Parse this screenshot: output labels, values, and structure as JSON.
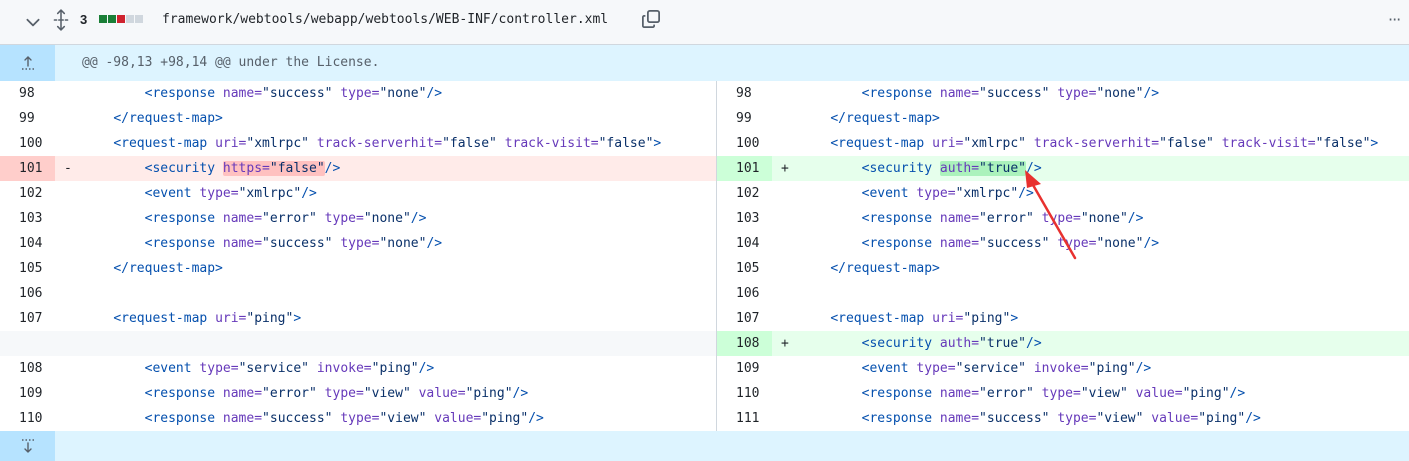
{
  "file": {
    "changes_count": "3",
    "path": "framework/webtools/webapp/webtools/WEB-INF/controller.xml",
    "diffstat": [
      "#1a7f37",
      "#1a7f37",
      "#cf222e",
      "#d0d7de",
      "#d0d7de"
    ],
    "icons": [
      "chevron-down-icon",
      "unfold-icon",
      "copy-icon",
      "kebab-horizontal-icon",
      "fold-up-icon",
      "fold-down-icon"
    ]
  },
  "hunk": {
    "header": "@@ -98,13 +98,14 @@ under the License."
  },
  "left": {
    "rows": [
      {
        "num": "98",
        "type": "ctx",
        "marker": "",
        "indent": "        ",
        "parts": [
          [
            "tag",
            "<response "
          ],
          [
            "attr",
            "name="
          ],
          [
            "str",
            "\"success\""
          ],
          [
            "plain",
            " "
          ],
          [
            "attr",
            "type="
          ],
          [
            "str",
            "\"none\""
          ],
          [
            "tag",
            "/>"
          ]
        ]
      },
      {
        "num": "99",
        "type": "ctx",
        "marker": "",
        "indent": "    ",
        "parts": [
          [
            "tag",
            "</request-map>"
          ]
        ]
      },
      {
        "num": "100",
        "type": "ctx",
        "marker": "",
        "indent": "    ",
        "parts": [
          [
            "tag",
            "<request-map "
          ],
          [
            "attr",
            "uri="
          ],
          [
            "str",
            "\"xmlrpc\""
          ],
          [
            "plain",
            " "
          ],
          [
            "attr",
            "track-serverhit="
          ],
          [
            "str",
            "\"false\""
          ],
          [
            "plain",
            " "
          ],
          [
            "attr",
            "track-visit="
          ],
          [
            "str",
            "\"false\""
          ],
          [
            "tag",
            ">"
          ]
        ]
      },
      {
        "num": "101",
        "type": "del",
        "marker": "-",
        "indent": "        ",
        "parts": [
          [
            "tag",
            "<security "
          ],
          [
            "hl-attr",
            "https="
          ],
          [
            "hl-str",
            "\"false\""
          ],
          [
            "tag",
            "/>"
          ]
        ]
      },
      {
        "num": "102",
        "type": "ctx",
        "marker": "",
        "indent": "        ",
        "parts": [
          [
            "tag",
            "<event "
          ],
          [
            "attr",
            "type="
          ],
          [
            "str",
            "\"xmlrpc\""
          ],
          [
            "tag",
            "/>"
          ]
        ]
      },
      {
        "num": "103",
        "type": "ctx",
        "marker": "",
        "indent": "        ",
        "parts": [
          [
            "tag",
            "<response "
          ],
          [
            "attr",
            "name="
          ],
          [
            "str",
            "\"error\""
          ],
          [
            "plain",
            " "
          ],
          [
            "attr",
            "type="
          ],
          [
            "str",
            "\"none\""
          ],
          [
            "tag",
            "/>"
          ]
        ]
      },
      {
        "num": "104",
        "type": "ctx",
        "marker": "",
        "indent": "        ",
        "parts": [
          [
            "tag",
            "<response "
          ],
          [
            "attr",
            "name="
          ],
          [
            "str",
            "\"success\""
          ],
          [
            "plain",
            " "
          ],
          [
            "attr",
            "type="
          ],
          [
            "str",
            "\"none\""
          ],
          [
            "tag",
            "/>"
          ]
        ]
      },
      {
        "num": "105",
        "type": "ctx",
        "marker": "",
        "indent": "    ",
        "parts": [
          [
            "tag",
            "</request-map>"
          ]
        ]
      },
      {
        "num": "106",
        "type": "ctx",
        "marker": "",
        "indent": "",
        "parts": []
      },
      {
        "num": "107",
        "type": "ctx",
        "marker": "",
        "indent": "    ",
        "parts": [
          [
            "tag",
            "<request-map "
          ],
          [
            "attr",
            "uri="
          ],
          [
            "str",
            "\"ping\""
          ],
          [
            "tag",
            ">"
          ]
        ]
      },
      {
        "num": "",
        "type": "empty",
        "marker": "",
        "indent": "",
        "parts": []
      },
      {
        "num": "108",
        "type": "ctx",
        "marker": "",
        "indent": "        ",
        "parts": [
          [
            "tag",
            "<event "
          ],
          [
            "attr",
            "type="
          ],
          [
            "str",
            "\"service\""
          ],
          [
            "plain",
            " "
          ],
          [
            "attr",
            "invoke="
          ],
          [
            "str",
            "\"ping\""
          ],
          [
            "tag",
            "/>"
          ]
        ]
      },
      {
        "num": "109",
        "type": "ctx",
        "marker": "",
        "indent": "        ",
        "parts": [
          [
            "tag",
            "<response "
          ],
          [
            "attr",
            "name="
          ],
          [
            "str",
            "\"error\""
          ],
          [
            "plain",
            " "
          ],
          [
            "attr",
            "type="
          ],
          [
            "str",
            "\"view\""
          ],
          [
            "plain",
            " "
          ],
          [
            "attr",
            "value="
          ],
          [
            "str",
            "\"ping\""
          ],
          [
            "tag",
            "/>"
          ]
        ]
      },
      {
        "num": "110",
        "type": "ctx",
        "marker": "",
        "indent": "        ",
        "parts": [
          [
            "tag",
            "<response "
          ],
          [
            "attr",
            "name="
          ],
          [
            "str",
            "\"success\""
          ],
          [
            "plain",
            " "
          ],
          [
            "attr",
            "type="
          ],
          [
            "str",
            "\"view\""
          ],
          [
            "plain",
            " "
          ],
          [
            "attr",
            "value="
          ],
          [
            "str",
            "\"ping\""
          ],
          [
            "tag",
            "/>"
          ]
        ]
      }
    ]
  },
  "right": {
    "rows": [
      {
        "num": "98",
        "type": "ctx",
        "marker": "",
        "indent": "        ",
        "parts": [
          [
            "tag",
            "<response "
          ],
          [
            "attr",
            "name="
          ],
          [
            "str",
            "\"success\""
          ],
          [
            "plain",
            " "
          ],
          [
            "attr",
            "type="
          ],
          [
            "str",
            "\"none\""
          ],
          [
            "tag",
            "/>"
          ]
        ]
      },
      {
        "num": "99",
        "type": "ctx",
        "marker": "",
        "indent": "    ",
        "parts": [
          [
            "tag",
            "</request-map>"
          ]
        ]
      },
      {
        "num": "100",
        "type": "ctx",
        "marker": "",
        "indent": "    ",
        "parts": [
          [
            "tag",
            "<request-map "
          ],
          [
            "attr",
            "uri="
          ],
          [
            "str",
            "\"xmlrpc\""
          ],
          [
            "plain",
            " "
          ],
          [
            "attr",
            "track-serverhit="
          ],
          [
            "str",
            "\"false\""
          ],
          [
            "plain",
            " "
          ],
          [
            "attr",
            "track-visit="
          ],
          [
            "str",
            "\"false\""
          ],
          [
            "tag",
            ">"
          ]
        ]
      },
      {
        "num": "101",
        "type": "add",
        "marker": "+",
        "indent": "        ",
        "parts": [
          [
            "tag",
            "<security "
          ],
          [
            "hl-attr",
            "auth="
          ],
          [
            "hl-str",
            "\"true\""
          ],
          [
            "tag",
            "/>"
          ]
        ]
      },
      {
        "num": "102",
        "type": "ctx",
        "marker": "",
        "indent": "        ",
        "parts": [
          [
            "tag",
            "<event "
          ],
          [
            "attr",
            "type="
          ],
          [
            "str",
            "\"xmlrpc\""
          ],
          [
            "tag",
            "/>"
          ]
        ]
      },
      {
        "num": "103",
        "type": "ctx",
        "marker": "",
        "indent": "        ",
        "parts": [
          [
            "tag",
            "<response "
          ],
          [
            "attr",
            "name="
          ],
          [
            "str",
            "\"error\""
          ],
          [
            "plain",
            " "
          ],
          [
            "attr",
            "type="
          ],
          [
            "str",
            "\"none\""
          ],
          [
            "tag",
            "/>"
          ]
        ]
      },
      {
        "num": "104",
        "type": "ctx",
        "marker": "",
        "indent": "        ",
        "parts": [
          [
            "tag",
            "<response "
          ],
          [
            "attr",
            "name="
          ],
          [
            "str",
            "\"success\""
          ],
          [
            "plain",
            " "
          ],
          [
            "attr",
            "type="
          ],
          [
            "str",
            "\"none\""
          ],
          [
            "tag",
            "/>"
          ]
        ]
      },
      {
        "num": "105",
        "type": "ctx",
        "marker": "",
        "indent": "    ",
        "parts": [
          [
            "tag",
            "</request-map>"
          ]
        ]
      },
      {
        "num": "106",
        "type": "ctx",
        "marker": "",
        "indent": "",
        "parts": []
      },
      {
        "num": "107",
        "type": "ctx",
        "marker": "",
        "indent": "    ",
        "parts": [
          [
            "tag",
            "<request-map "
          ],
          [
            "attr",
            "uri="
          ],
          [
            "str",
            "\"ping\""
          ],
          [
            "tag",
            ">"
          ]
        ]
      },
      {
        "num": "108",
        "type": "add",
        "marker": "+",
        "indent": "        ",
        "parts": [
          [
            "tag",
            "<security "
          ],
          [
            "attr",
            "auth="
          ],
          [
            "str",
            "\"true\""
          ],
          [
            "tag",
            "/>"
          ]
        ]
      },
      {
        "num": "109",
        "type": "ctx",
        "marker": "",
        "indent": "        ",
        "parts": [
          [
            "tag",
            "<event "
          ],
          [
            "attr",
            "type="
          ],
          [
            "str",
            "\"service\""
          ],
          [
            "plain",
            " "
          ],
          [
            "attr",
            "invoke="
          ],
          [
            "str",
            "\"ping\""
          ],
          [
            "tag",
            "/>"
          ]
        ]
      },
      {
        "num": "110",
        "type": "ctx",
        "marker": "",
        "indent": "        ",
        "parts": [
          [
            "tag",
            "<response "
          ],
          [
            "attr",
            "name="
          ],
          [
            "str",
            "\"error\""
          ],
          [
            "plain",
            " "
          ],
          [
            "attr",
            "type="
          ],
          [
            "str",
            "\"view\""
          ],
          [
            "plain",
            " "
          ],
          [
            "attr",
            "value="
          ],
          [
            "str",
            "\"ping\""
          ],
          [
            "tag",
            "/>"
          ]
        ]
      },
      {
        "num": "111",
        "type": "ctx",
        "marker": "",
        "indent": "        ",
        "parts": [
          [
            "tag",
            "<response "
          ],
          [
            "attr",
            "name="
          ],
          [
            "str",
            "\"success\""
          ],
          [
            "plain",
            " "
          ],
          [
            "attr",
            "type="
          ],
          [
            "str",
            "\"view\""
          ],
          [
            "plain",
            " "
          ],
          [
            "attr",
            "value="
          ],
          [
            "str",
            "\"ping\""
          ],
          [
            "tag",
            "/>"
          ]
        ]
      }
    ]
  },
  "annotation": {
    "arrow_color": "#e8312f"
  }
}
